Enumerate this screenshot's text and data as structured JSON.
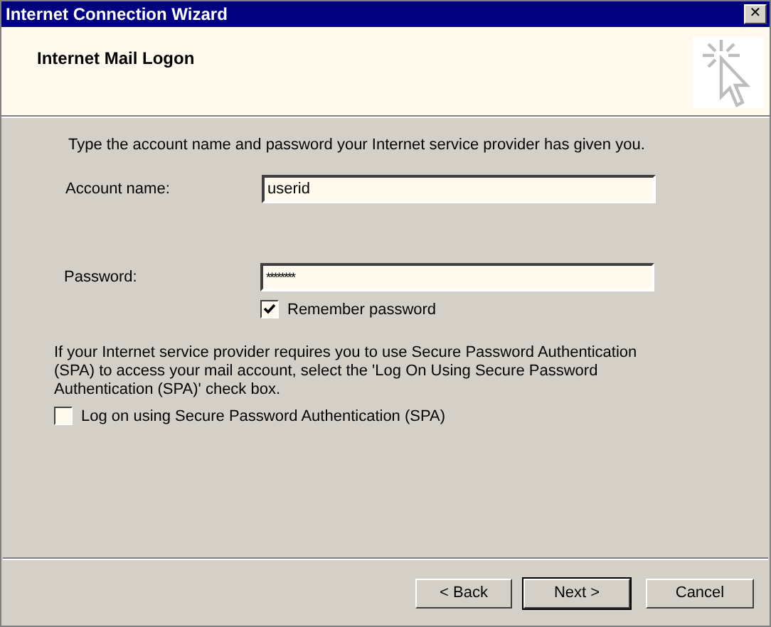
{
  "window": {
    "title": "Internet Connection Wizard",
    "close_glyph": "✕"
  },
  "header": {
    "title": "Internet Mail Logon"
  },
  "instruction": "Type the account name and password your Internet service provider has given you.",
  "fields": [
    {
      "label": "Account name:",
      "value": "userid",
      "kind": "text"
    },
    {
      "label": "Password:",
      "value": "********",
      "kind": "password"
    }
  ],
  "remember_password": {
    "label": "Remember password",
    "checked": true
  },
  "spa_note": "If your Internet service provider requires you to use Secure Password Authentication (SPA) to access your mail account, select the 'Log On Using Secure Password Authentication (SPA)' check box.",
  "spa_checkbox": {
    "label": "Log on using Secure Password Authentication (SPA)",
    "checked": false
  },
  "buttons": [
    {
      "label": "< Back",
      "default": false
    },
    {
      "label": "Next >",
      "default": true
    },
    {
      "label": "Cancel",
      "default": false
    }
  ]
}
